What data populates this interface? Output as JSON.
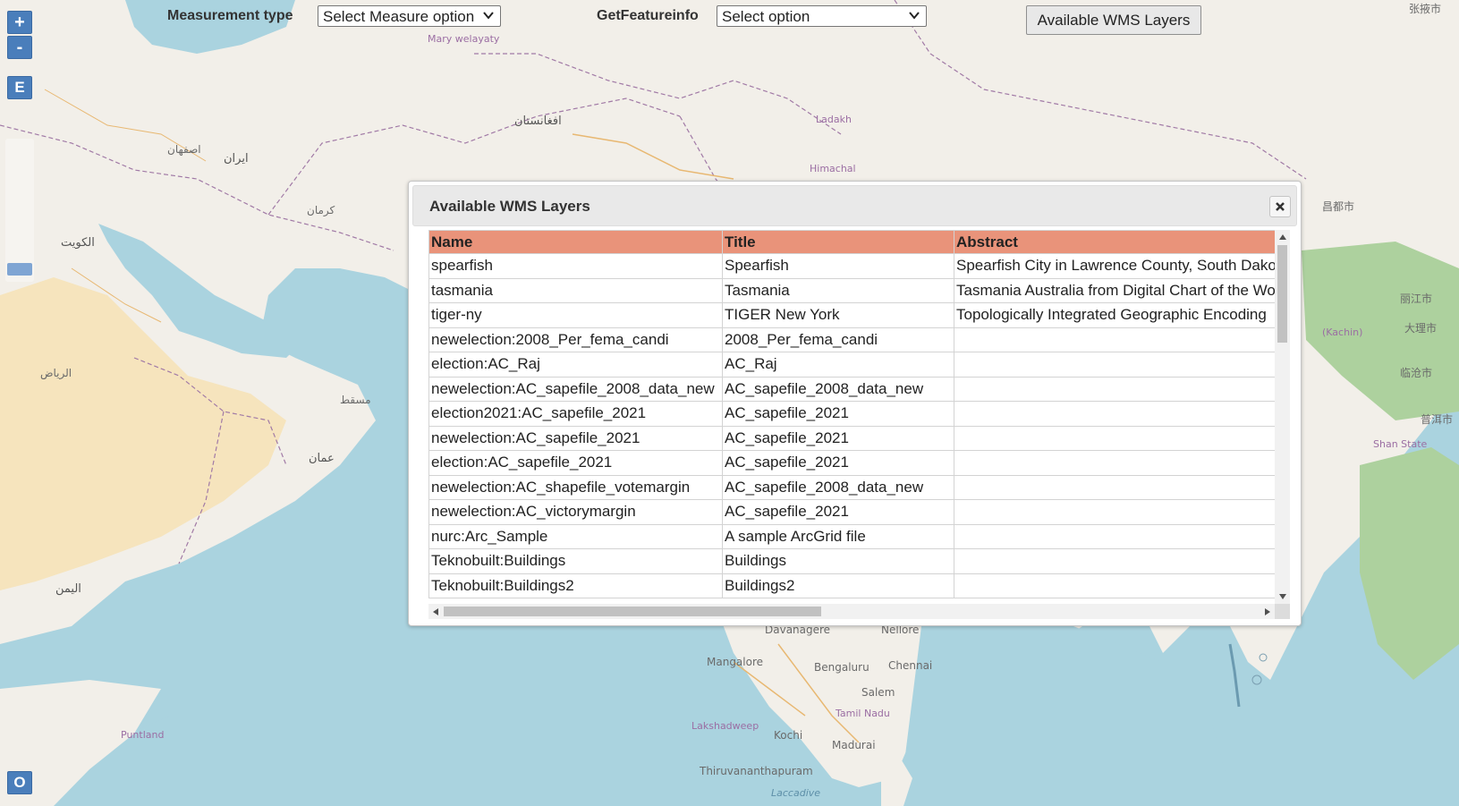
{
  "map_controls": {
    "zoom_in": "+",
    "zoom_out": "-",
    "edit": "E",
    "overview": "O"
  },
  "toolbar": {
    "measurement_label": "Measurement type",
    "measurement_select": "Select Measure option",
    "getfeature_label": "GetFeatureinfo",
    "getfeature_select": "Select option",
    "wms_button": "Available WMS Layers"
  },
  "dialog": {
    "title": "Available WMS Layers",
    "columns": [
      "Name",
      "Title",
      "Abstract"
    ],
    "rows": [
      [
        "spearfish",
        "Spearfish",
        "Spearfish City in Lawrence County, South Dakota"
      ],
      [
        "tasmania",
        "Tasmania",
        "Tasmania Australia from Digital Chart of the World"
      ],
      [
        "tiger-ny",
        "TIGER New York",
        "Topologically Integrated Geographic Encoding"
      ],
      [
        "newelection:2008_Per_fema_candi",
        "2008_Per_fema_candi",
        ""
      ],
      [
        "election:AC_Raj",
        "AC_Raj",
        ""
      ],
      [
        "newelection:AC_sapefile_2008_data_new",
        "AC_sapefile_2008_data_new",
        ""
      ],
      [
        "election2021:AC_sapefile_2021",
        "AC_sapefile_2021",
        ""
      ],
      [
        "newelection:AC_sapefile_2021",
        "AC_sapefile_2021",
        ""
      ],
      [
        "election:AC_sapefile_2021",
        "AC_sapefile_2021",
        ""
      ],
      [
        "newelection:AC_shapefile_votemargin",
        "AC_sapefile_2008_data_new",
        ""
      ],
      [
        "newelection:AC_victorymargin",
        "AC_sapefile_2021",
        ""
      ],
      [
        "nurc:Arc_Sample",
        "A sample ArcGrid file",
        ""
      ],
      [
        "Teknobuilt:Buildings",
        "Buildings",
        ""
      ],
      [
        "Teknobuilt:Buildings2",
        "Buildings2",
        ""
      ]
    ]
  },
  "map_labels": [
    {
      "text": "Mary welayaty",
      "cls": "purple"
    },
    {
      "text": "Ladakh",
      "cls": "purple"
    },
    {
      "text": "Himachal",
      "cls": "purple"
    },
    {
      "text": "Davanagere",
      "cls": "md"
    },
    {
      "text": "Nellore",
      "cls": "md"
    },
    {
      "text": "Mangalore",
      "cls": "md"
    },
    {
      "text": "Bengaluru",
      "cls": "md"
    },
    {
      "text": "Chennai",
      "cls": "md"
    },
    {
      "text": "Salem",
      "cls": "md"
    },
    {
      "text": "Tamil Nadu",
      "cls": "purple"
    },
    {
      "text": "Lakshadweep",
      "cls": "purple"
    },
    {
      "text": "Kochi",
      "cls": "md"
    },
    {
      "text": "Madurai",
      "cls": "md"
    },
    {
      "text": "Thiruvananthapuram",
      "cls": "md"
    },
    {
      "text": "Laccadive",
      "cls": "water"
    },
    {
      "text": "Puntland",
      "cls": "purple"
    },
    {
      "text": "Shan State",
      "cls": "purple"
    },
    {
      "text": "(Kachin)",
      "cls": "purple"
    },
    {
      "text": "昌都市",
      "cls": "md"
    },
    {
      "text": "丽江市",
      "cls": "md"
    },
    {
      "text": "大理市",
      "cls": "md"
    },
    {
      "text": "临沧市",
      "cls": "md"
    },
    {
      "text": "普洱市",
      "cls": "md"
    },
    {
      "text": "张掖市",
      "cls": "md"
    },
    {
      "text": "عمان",
      "cls": "lg"
    },
    {
      "text": "الكويت",
      "cls": "lg"
    },
    {
      "text": "ایران",
      "cls": "lg"
    },
    {
      "text": "اليمن",
      "cls": "lg"
    },
    {
      "text": "مسقط",
      "cls": "md"
    },
    {
      "text": "الرياض",
      "cls": "md"
    },
    {
      "text": "اصفهان",
      "cls": "md"
    },
    {
      "text": "کرمان",
      "cls": "md"
    },
    {
      "text": "افغانستان",
      "cls": "lg"
    }
  ],
  "colors": {
    "water": "#aad3df",
    "land": "#f2efe9",
    "desert": "#f6e4bd",
    "forest": "#add19e",
    "table_header": "#e9937a",
    "control_blue": "#4a7ebb"
  }
}
